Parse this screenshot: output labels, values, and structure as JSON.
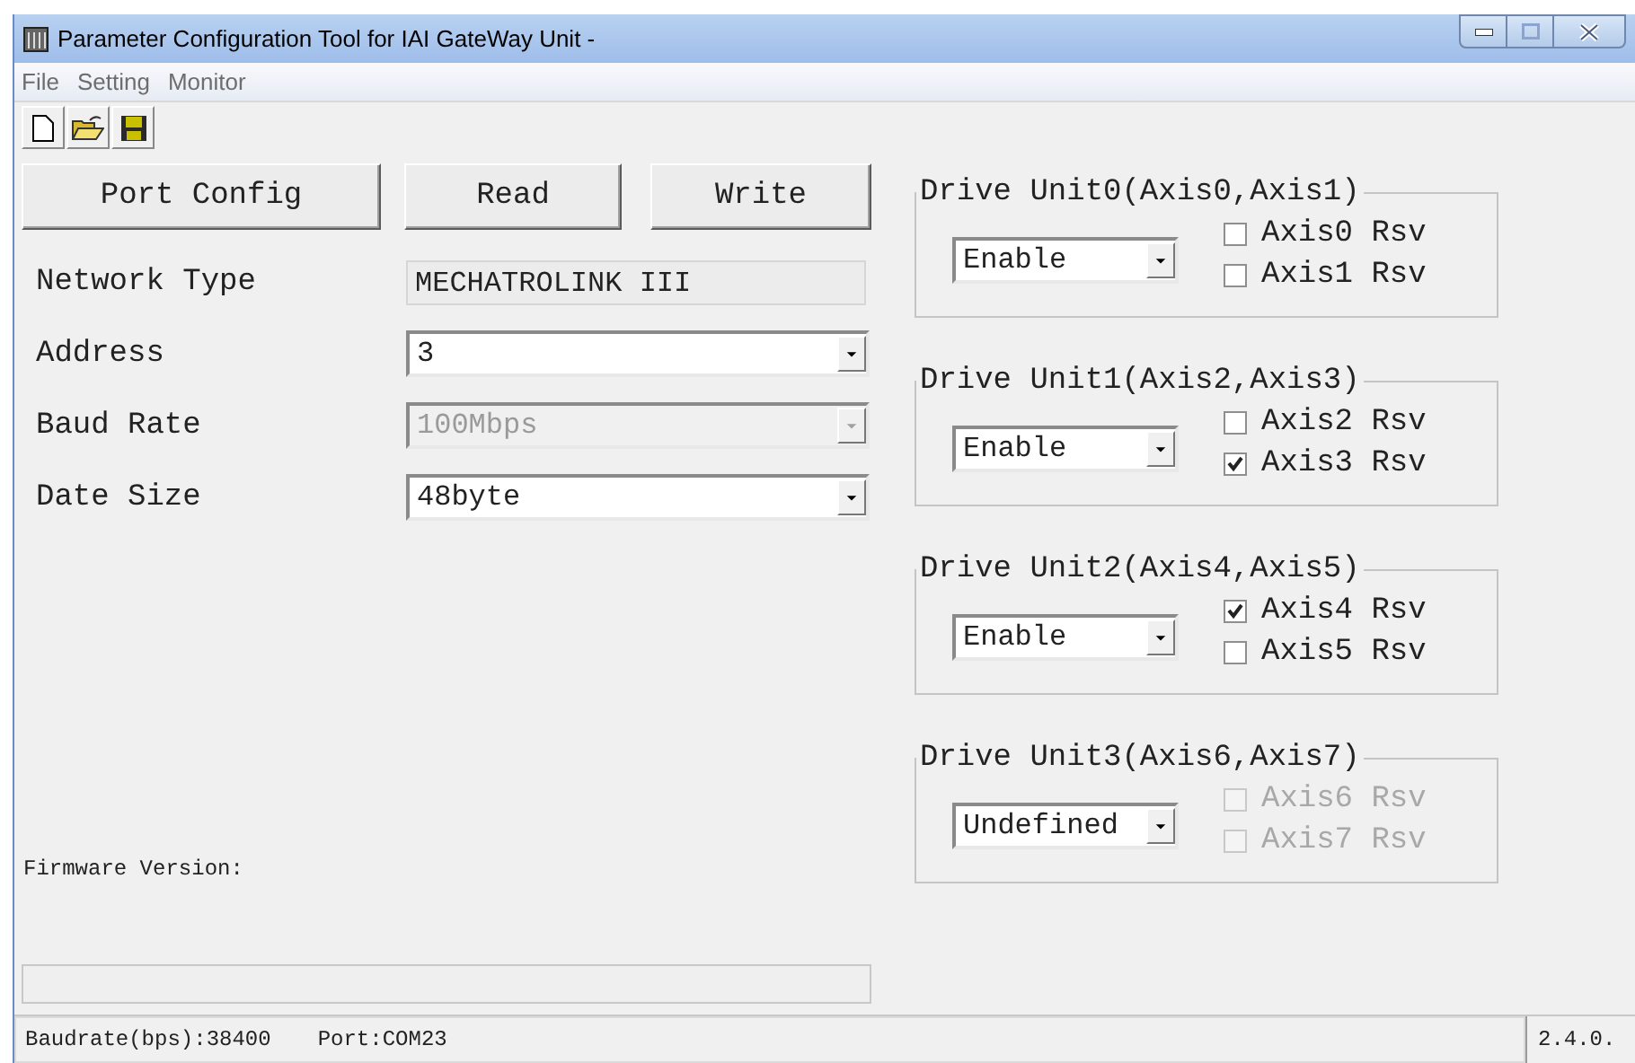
{
  "window": {
    "title": "Parameter Configuration Tool for IAI GateWay Unit -"
  },
  "menu": [
    "File",
    "Setting",
    "Monitor"
  ],
  "toolbar": [
    {
      "kind": "new"
    },
    {
      "kind": "open"
    },
    {
      "kind": "save"
    }
  ],
  "buttons": [
    "Port Config",
    "Read",
    "Write"
  ],
  "fields": [
    {
      "label": "Network Type",
      "kind": "readonly",
      "value": "MECHATROLINK III",
      "disabled": false
    },
    {
      "label": "Address",
      "kind": "combo",
      "value": "3",
      "disabled": false
    },
    {
      "label": "Baud Rate",
      "kind": "combo",
      "value": "100Mbps",
      "disabled": true
    },
    {
      "label": "Date Size",
      "kind": "combo",
      "value": "48byte",
      "disabled": false
    }
  ],
  "firmware_version": {
    "label": "Firmware Version:"
  },
  "drive_units": [
    {
      "title": "Drive Unit0(Axis0,Axis1)",
      "mode": "Enable",
      "axes": [
        {
          "label": "Axis0 Rsv",
          "checked": false,
          "disabled": false
        },
        {
          "label": "Axis1 Rsv",
          "checked": false,
          "disabled": false
        }
      ]
    },
    {
      "title": "Drive Unit1(Axis2,Axis3)",
      "mode": "Enable",
      "axes": [
        {
          "label": "Axis2 Rsv",
          "checked": false,
          "disabled": false
        },
        {
          "label": "Axis3 Rsv",
          "checked": true,
          "disabled": false
        }
      ]
    },
    {
      "title": "Drive Unit2(Axis4,Axis5)",
      "mode": "Enable",
      "axes": [
        {
          "label": "Axis4 Rsv",
          "checked": true,
          "disabled": false
        },
        {
          "label": "Axis5 Rsv",
          "checked": false,
          "disabled": false
        }
      ]
    },
    {
      "title": "Drive Unit3(Axis6,Axis7)",
      "mode": "Undefined",
      "axes": [
        {
          "label": "Axis6 Rsv",
          "checked": false,
          "disabled": true
        },
        {
          "label": "Axis7 Rsv",
          "checked": false,
          "disabled": true
        }
      ]
    }
  ],
  "status_bar": {
    "baudrate": "Baudrate(bps):38400",
    "port": "Port:COM23",
    "version": "2.4.0."
  }
}
